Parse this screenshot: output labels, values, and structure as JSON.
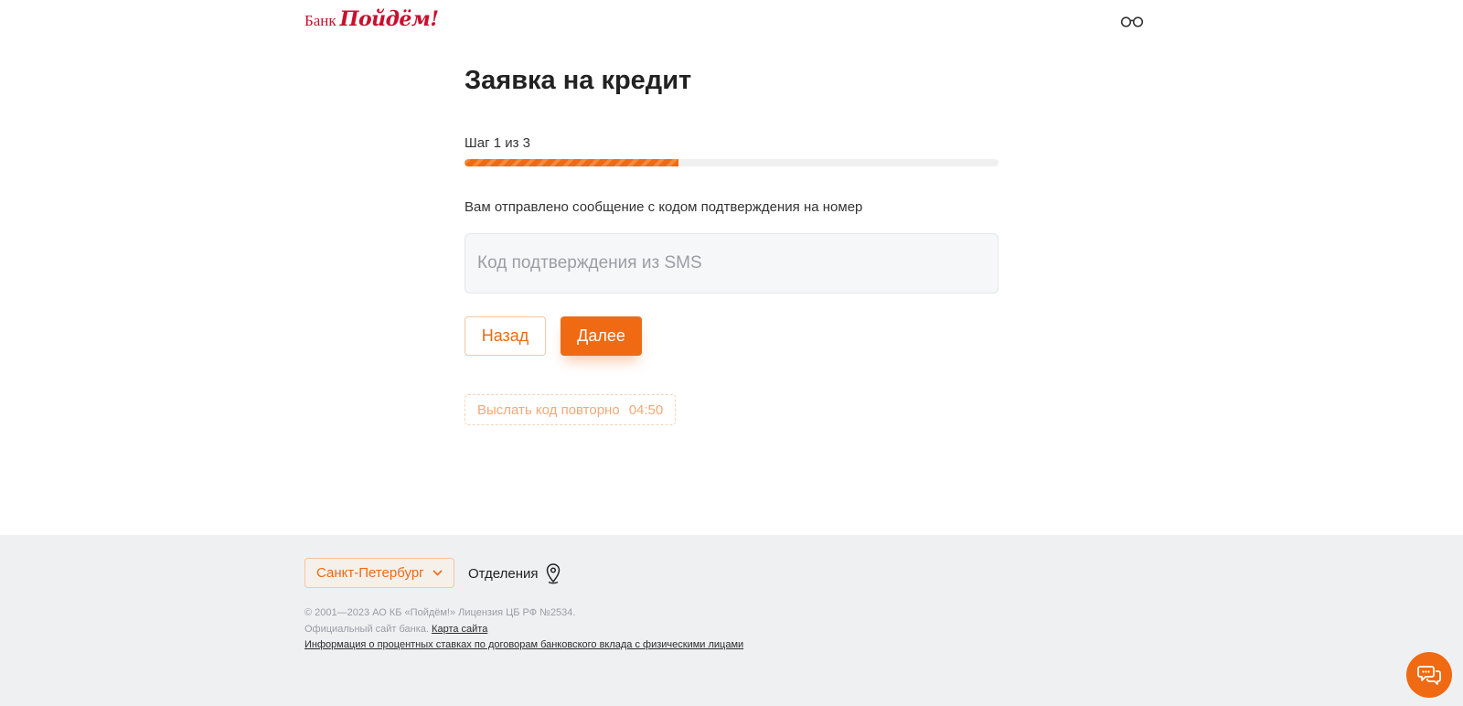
{
  "header": {
    "logo_bank": "Банк",
    "logo_name": "Пойдём!",
    "accessibility_icon": "glasses-icon"
  },
  "main": {
    "title": "Заявка на кредит",
    "step_label": "Шаг 1 из 3",
    "progress_fraction": 0.4,
    "sms_message": "Вам отправлено сообщение с кодом подтверждения на номер",
    "code_placeholder": "Код подтверждения из SMS",
    "code_value": "",
    "back_label": "Назад",
    "next_label": "Далее",
    "resend_label": "Выслать код повторно",
    "resend_timer": "04:50"
  },
  "footer": {
    "city": "Санкт-Петербург",
    "branches_label": "Отделения",
    "copyright": "© 2001—2023 АО КБ «Пойдём!» Лицензия ЦБ РФ №2534.",
    "official_site": "Официальный сайт банка.",
    "sitemap_link": "Карта сайта",
    "rates_link": "Информация о процентных ставках по договорам банковского вклада с физическими лицами"
  },
  "colors": {
    "accent": "#ef6a12",
    "brand_red": "#c8102e",
    "footer_bg": "#eff0f2"
  },
  "icons": [
    "glasses-icon",
    "chevron-down-icon",
    "location-pin-icon",
    "chat-icon"
  ]
}
